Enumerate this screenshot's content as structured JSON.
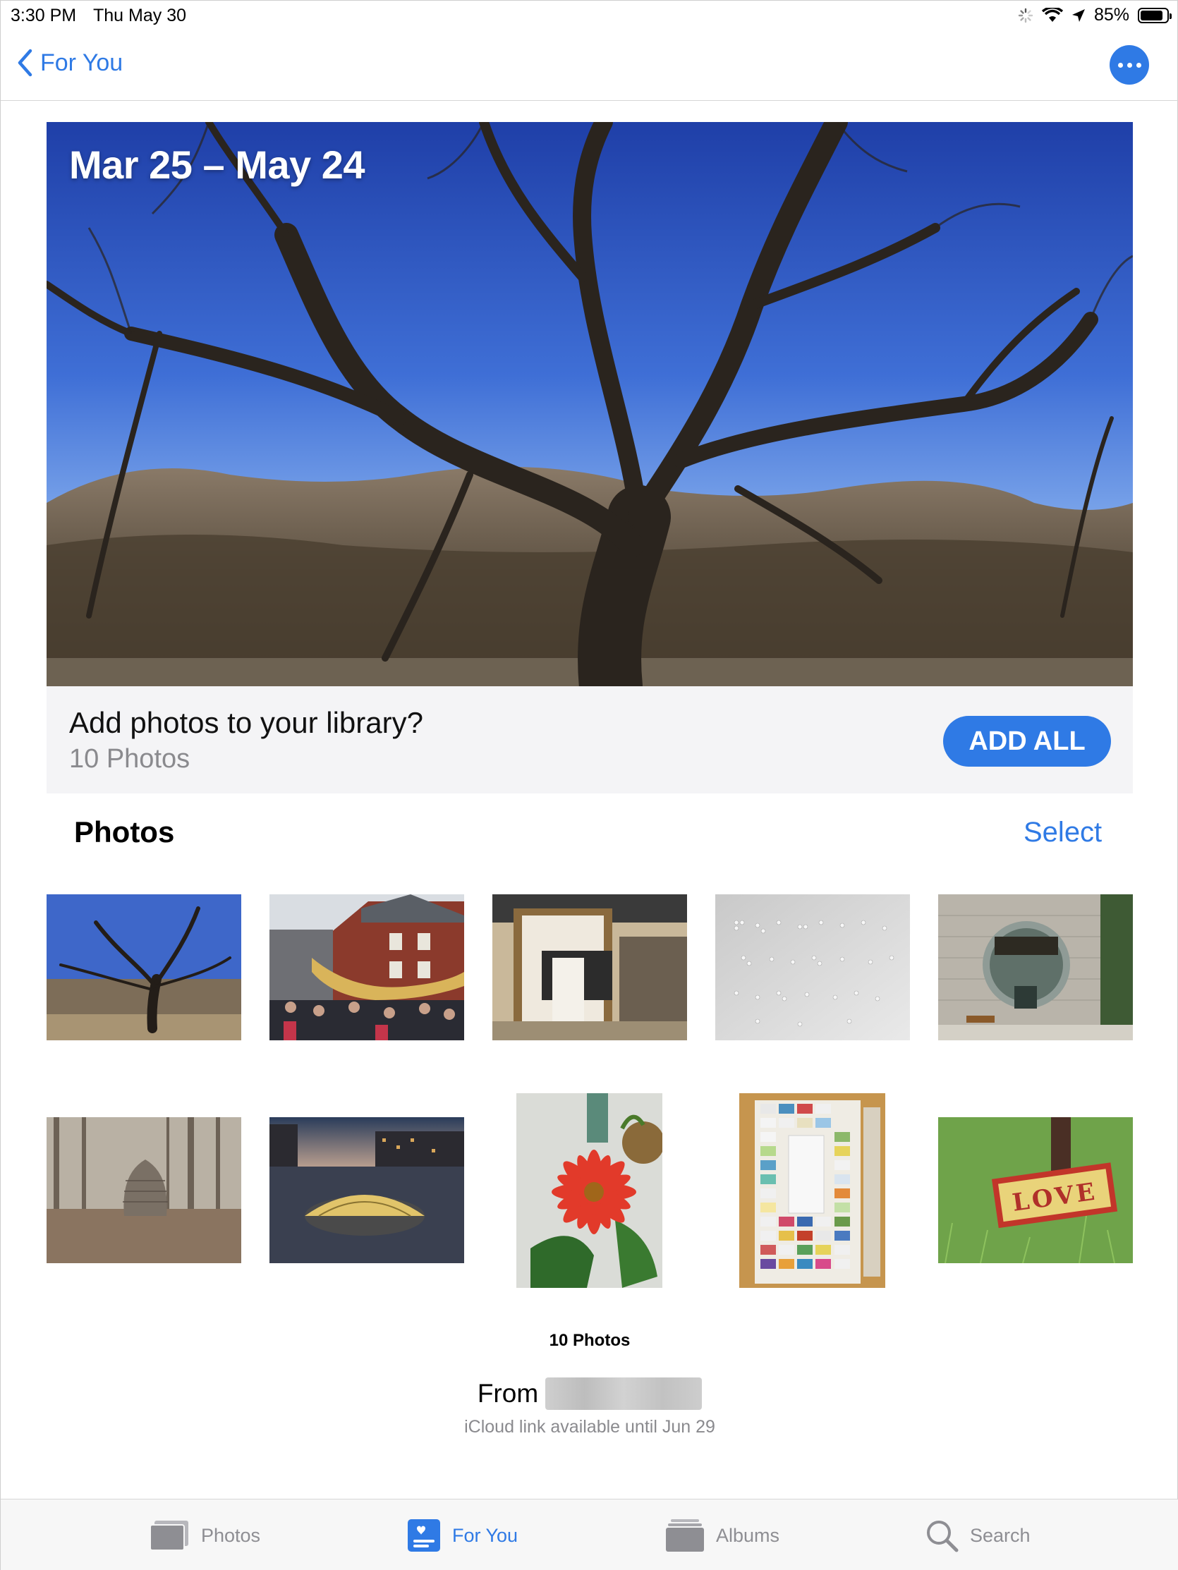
{
  "status_bar": {
    "time": "3:30 PM",
    "date": "Thu May 30",
    "battery": "85%",
    "battery_level": 0.85
  },
  "nav": {
    "back_label": "For You"
  },
  "hero": {
    "title": "Mar 25 – May 24"
  },
  "add_panel": {
    "title": "Add photos to your library?",
    "count": "10 Photos",
    "button_label": "ADD ALL"
  },
  "photos_section": {
    "title": "Photos",
    "select_label": "Select",
    "thumbnails": [
      "tree",
      "parade-dragon",
      "library-printer",
      "braille-paper",
      "round-window-building",
      "stone-cairn",
      "glass-dome-dusk",
      "red-gerbera-flower",
      "parking-permits-door",
      "love-sign"
    ]
  },
  "footer": {
    "count_label": "10 Photos",
    "from_label": "From",
    "icloud_note": "iCloud link available until Jun 29"
  },
  "tab_bar": {
    "tabs": [
      {
        "label": "Photos",
        "icon": "photos-stack-icon",
        "active": false
      },
      {
        "label": "For You",
        "icon": "for-you-icon",
        "active": true
      },
      {
        "label": "Albums",
        "icon": "albums-icon",
        "active": false
      },
      {
        "label": "Search",
        "icon": "search-icon",
        "active": false
      }
    ]
  },
  "colors": {
    "accent": "#2f7ae5",
    "inactive_tab": "#8e8e93",
    "panel_bg": "#f4f4f6"
  }
}
